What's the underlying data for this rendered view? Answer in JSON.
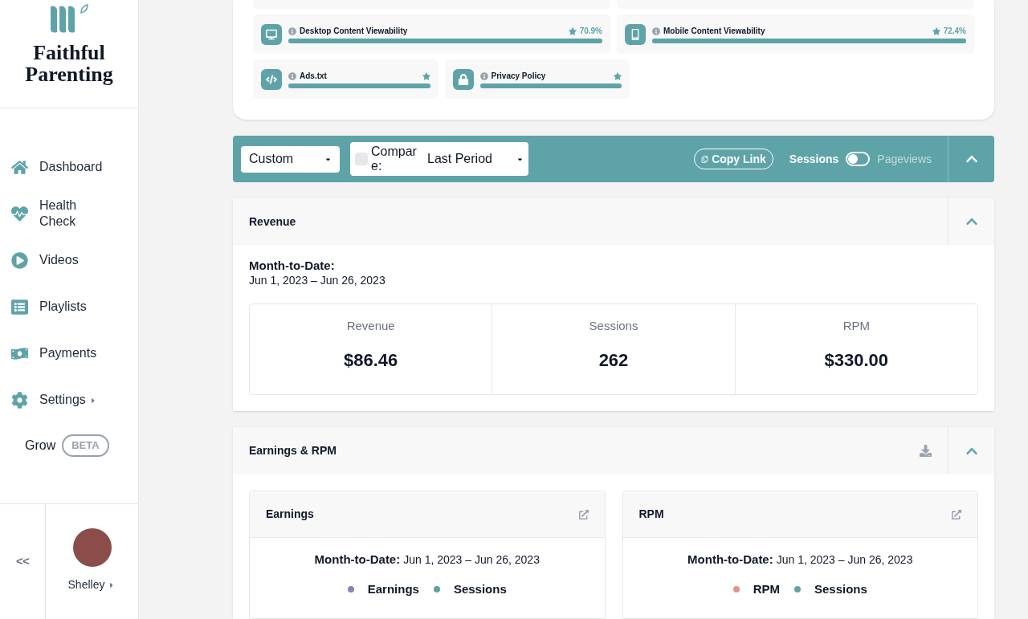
{
  "brand": {
    "name": "Faithful Parenting"
  },
  "nav": [
    {
      "label": "Dashboard",
      "submenu": false
    },
    {
      "label": "Health Check",
      "submenu": false
    },
    {
      "label": "Videos",
      "submenu": false
    },
    {
      "label": "Playlists",
      "submenu": false
    },
    {
      "label": "Payments",
      "submenu": false
    },
    {
      "label": "Settings",
      "submenu": true
    }
  ],
  "grow": {
    "label": "Grow",
    "badge": "BETA"
  },
  "collapse": "<<",
  "user": {
    "name": "Shelley"
  },
  "health_rows": [
    [
      {
        "title": "Desktop Content Viewability",
        "value": "70.9%",
        "level": 1
      },
      {
        "title": "Mobile Content Viewability",
        "value": "72.4%",
        "level": 1
      }
    ],
    [
      {
        "title": "Ads.txt",
        "level": 1
      },
      {
        "title": "Privacy Policy",
        "level": 1
      }
    ]
  ],
  "toolbar": {
    "range": "Custom",
    "compare_checked": false,
    "compare_label": "Compare:",
    "compare_value": "Last Period",
    "copy_link": "Copy Link",
    "toggle": {
      "left": "Sessions",
      "right": "Pageviews",
      "on": false
    }
  },
  "revenue": {
    "title": "Revenue",
    "period_label": "Month-to-Date:",
    "period": "Jun 1, 2023 – Jun 26, 2023",
    "stats": [
      {
        "label": "Revenue",
        "value": "$86.46"
      },
      {
        "label": "Sessions",
        "value": "262"
      },
      {
        "label": "RPM",
        "value": "$330.00"
      }
    ]
  },
  "earnings": {
    "title": "Earnings & RPM",
    "cards": [
      {
        "title": "Earnings",
        "period_label": "Month-to-Date:",
        "period": "Jun 1, 2023 – Jun 26, 2023",
        "legend": [
          {
            "label": "Earnings",
            "color": "#8a82b0"
          },
          {
            "label": "Sessions",
            "color": "#5ea3a8"
          }
        ]
      },
      {
        "title": "RPM",
        "period_label": "Month-to-Date:",
        "period": "Jun 1, 2023 – Jun 26, 2023",
        "legend": [
          {
            "label": "RPM",
            "color": "#e0968f"
          },
          {
            "label": "Sessions",
            "color": "#5ea3a8"
          }
        ]
      }
    ]
  }
}
